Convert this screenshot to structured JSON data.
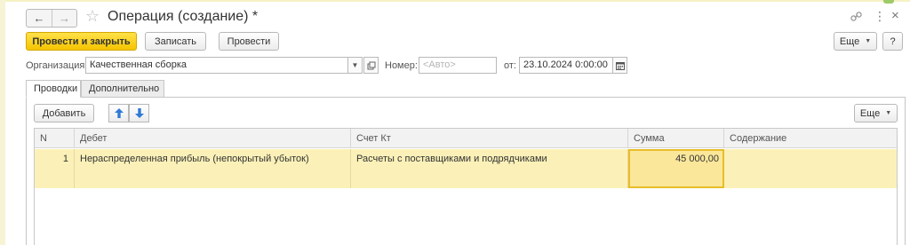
{
  "window": {
    "title": "Операция (создание) *",
    "nav_back": "←",
    "nav_forward": "→",
    "star_glyph": "☆",
    "link_glyph": "🔗",
    "more_glyph": "⋮",
    "close_glyph": "×"
  },
  "toolbar": {
    "post_and_close_label": "Провести и закрыть",
    "save_label": "Записать",
    "post_label": "Провести",
    "more_label": "Еще",
    "help_label": "?"
  },
  "form": {
    "organization_label": "Организация:",
    "organization_value": "Качественная сборка",
    "number_label": "Номер:",
    "number_placeholder": "<Авто>",
    "date_label": "от:",
    "date_value": "23.10.2024  0:00:00"
  },
  "tabs": [
    {
      "label": "Проводки",
      "active": true
    },
    {
      "label": "Дополнительно",
      "active": false
    }
  ],
  "table_toolbar": {
    "add_label": "Добавить",
    "up_glyph": "🡅",
    "down_glyph": "🡇",
    "more_label": "Еще"
  },
  "table": {
    "columns": [
      "N",
      "Дебет",
      "Счет Кт",
      "Сумма",
      "Содержание"
    ],
    "rows": [
      {
        "n": "1",
        "debit": "Нераспределенная прибыль (непокрытый убыток)",
        "credit_account": "Расчеты с поставщиками и подрядчиками",
        "sum": "45 000,00",
        "content": ""
      }
    ]
  },
  "colors": {
    "primary_button": "#f5c400",
    "selected_row": "#fbf1b8",
    "active_cell_border": "#e7bd2a",
    "arrow_blue": "#2f7ad6"
  }
}
